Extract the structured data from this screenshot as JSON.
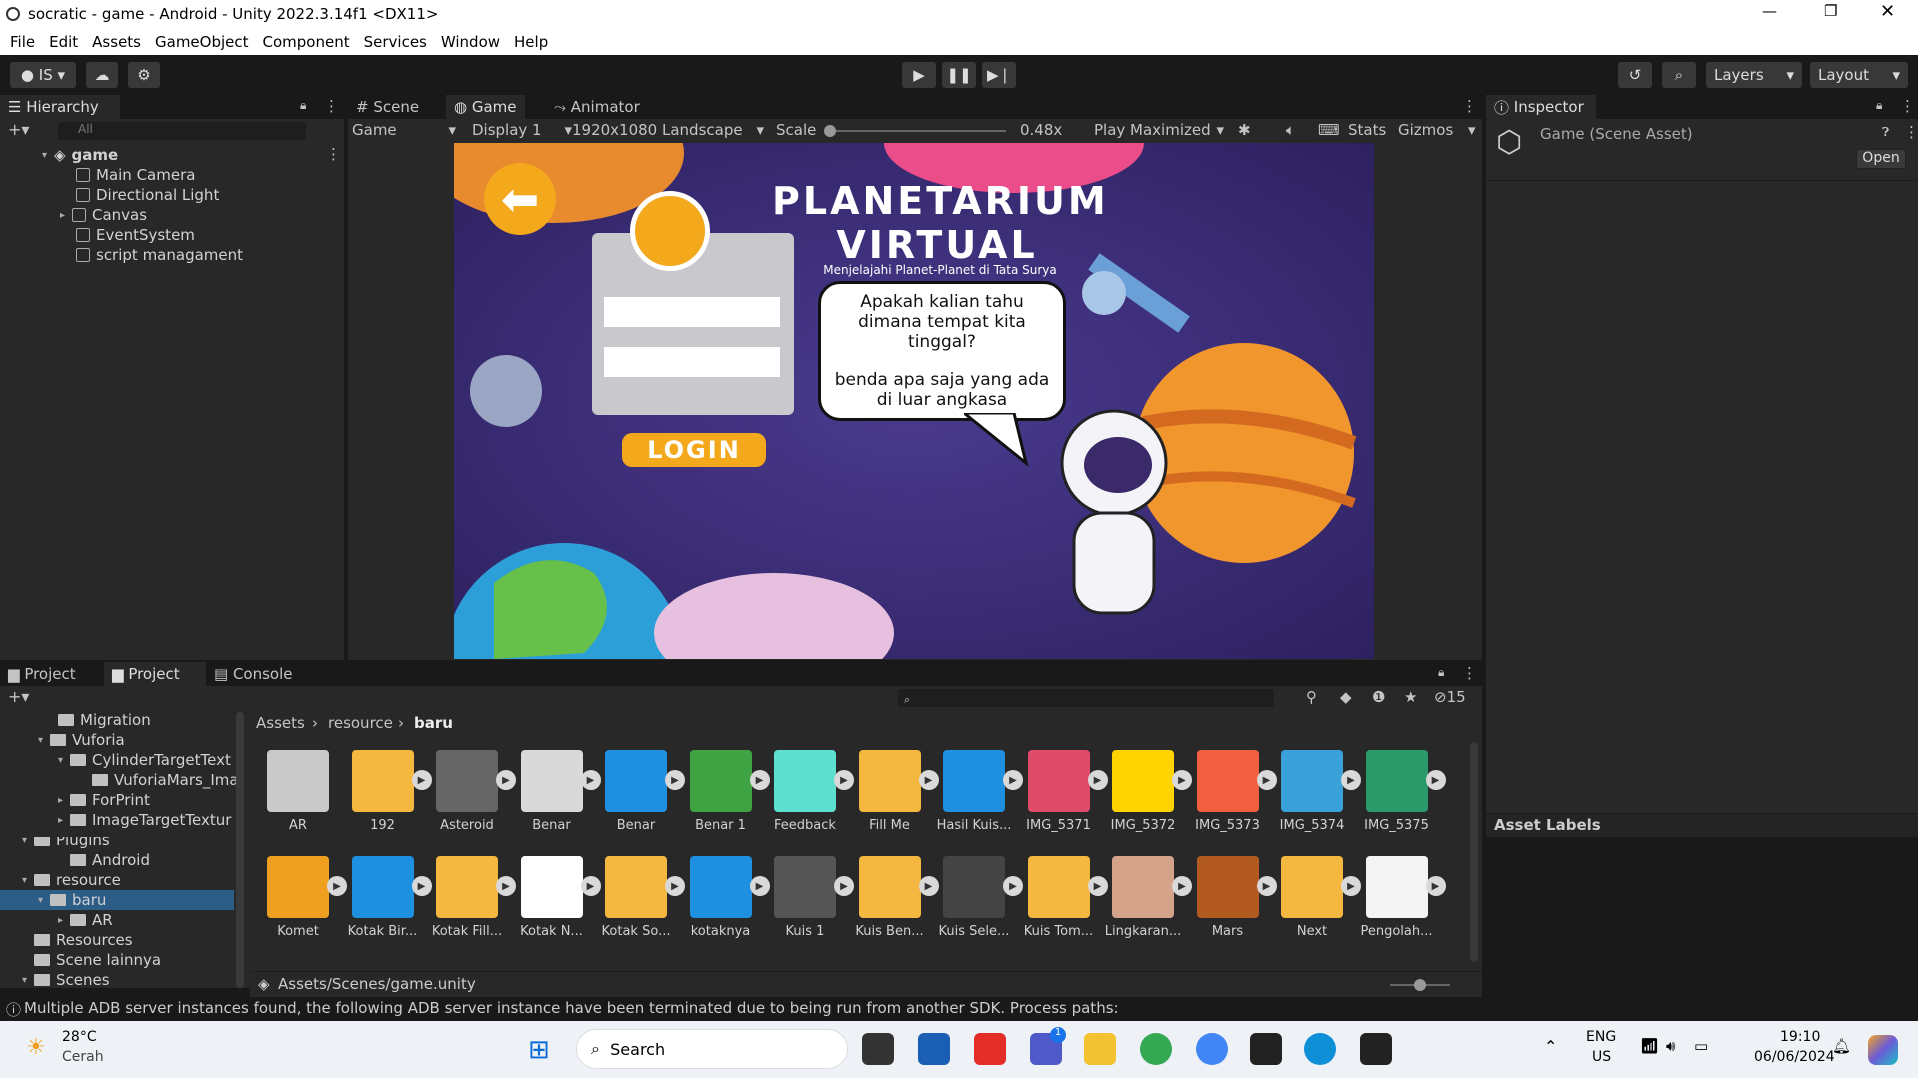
{
  "window": {
    "title": "socratic - game - Android - Unity 2022.3.14f1 <DX11>"
  },
  "menu": [
    "File",
    "Edit",
    "Assets",
    "GameObject",
    "Component",
    "Services",
    "Window",
    "Help"
  ],
  "toolbar": {
    "account": "IS",
    "layers": "Layers",
    "layout": "Layout"
  },
  "hierarchy": {
    "tab": "Hierarchy",
    "search_placeholder": "All",
    "scene": "game",
    "items": [
      "Main Camera",
      "Directional Light",
      "Canvas",
      "EventSystem",
      "script managament"
    ]
  },
  "game_view": {
    "tabs": [
      "Scene",
      "Game",
      "Animator"
    ],
    "game_dropdown": "Game",
    "display": "Display 1",
    "resolution": "1920x1080 Landscape",
    "scale_label": "Scale",
    "scale_value": "0.48x",
    "play_mode": "Play Maximized",
    "stats": "Stats",
    "gizmos": "Gizmos"
  },
  "game_screen": {
    "title_line1": "PLANETARIUM",
    "title_line2": "VIRTUAL",
    "subtitle": "Menjelajahi Planet-Planet di Tata Surya",
    "bubble_line1": "Apakah kalian tahu",
    "bubble_line2": "dimana tempat kita",
    "bubble_line3": "tinggal?",
    "bubble_line4": "benda apa saja yang ada",
    "bubble_line5": "di luar angkasa",
    "login_button": "LOGIN"
  },
  "inspector": {
    "tab": "Inspector",
    "asset": "Game (Scene Asset)",
    "open_button": "Open",
    "asset_labels": "Asset Labels"
  },
  "project": {
    "tabs": [
      "Project",
      "Project",
      "Console"
    ],
    "breadcrumb": [
      "Assets",
      "resource",
      "baru"
    ],
    "hidden_count": "15",
    "path": "Assets/Scenes/game.unity",
    "tree": [
      "Migration",
      "Vuforia",
      "CylinderTargetText",
      "VuforiaMars_Ima",
      "ForPrint",
      "ImageTargetTextur",
      "Plugins",
      "Android",
      "resource",
      "baru",
      "AR",
      "Resources",
      "Scene lainnya",
      "Scenes"
    ],
    "assets_row1": [
      "AR",
      "192",
      "Asteroid",
      "Benar",
      "Benar",
      "Benar 1",
      "Feedback",
      "Fill Me",
      "Hasil Kuis...",
      "IMG_5371",
      "IMG_5372",
      "IMG_5373",
      "IMG_5374",
      "IMG_5375"
    ],
    "assets_row2": [
      "Komet",
      "Kotak Bir...",
      "Kotak Fill...",
      "Kotak N...",
      "Kotak So...",
      "kotaknya",
      "Kuis 1",
      "Kuis Ben...",
      "Kuis Sele...",
      "Kuis Tom...",
      "Lingkaran...",
      "Mars",
      "Next",
      "Pengolah..."
    ]
  },
  "status": {
    "message": "Multiple ADB server instances found, the following ADB server instance have been terminated due to being run from another SDK. Process paths:"
  },
  "taskbar": {
    "weather_temp": "28°C",
    "weather_desc": "Cerah",
    "search": "Search",
    "lang1": "ENG",
    "lang2": "US",
    "time": "19:10",
    "date": "06/06/2024",
    "badge": "1"
  }
}
